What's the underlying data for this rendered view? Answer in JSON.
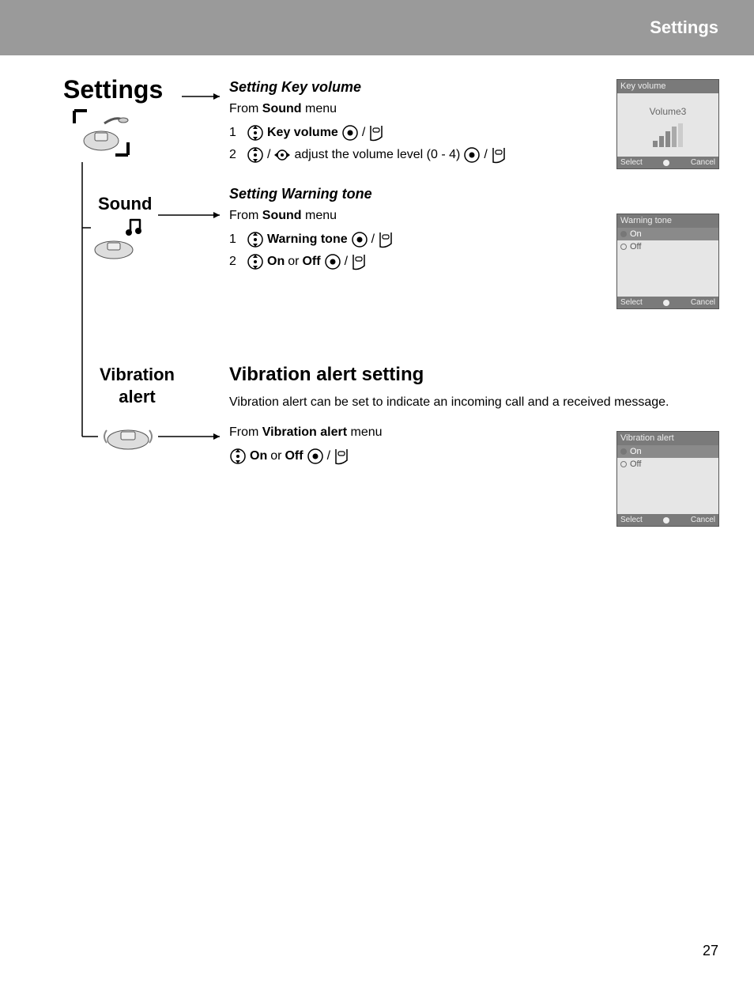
{
  "header": {
    "title": "Settings"
  },
  "page_number": "27",
  "left": {
    "settings_title": "Settings",
    "sound_label": "Sound",
    "vibration_label_line1": "Vibration",
    "vibration_label_line2": "alert"
  },
  "keyvol": {
    "heading": "Setting Key volume",
    "from_pre": "From ",
    "from_bold": "Sound",
    "from_post": " menu",
    "step1_num": "1",
    "step1_bold": "Key volume",
    "step1_sep": " / ",
    "step2_num": "2",
    "step2_sep1": " / ",
    "step2_text": " adjust the volume level (0 - 4) ",
    "step2_sep2": " / "
  },
  "warntone": {
    "heading": "Setting Warning tone",
    "from_pre": "From ",
    "from_bold": "Sound",
    "from_post": " menu",
    "step1_num": "1",
    "step1_bold": "Warning tone",
    "step1_sep": " / ",
    "step2_num": "2",
    "step2_on": "On",
    "step2_or": " or ",
    "step2_off": "Off",
    "step2_sep": " / "
  },
  "vibalert": {
    "heading": "Vibration alert setting",
    "desc": "Vibration alert can be set to indicate an incoming call and a received message.",
    "from_pre": "From ",
    "from_bold": "Vibration alert",
    "from_post": " menu",
    "step_on": "On",
    "step_or": " or ",
    "step_off": "Off",
    "step_sep": " / "
  },
  "screens": {
    "keyvol": {
      "title": "Key volume",
      "value": "Volume3",
      "select": "Select",
      "cancel": "Cancel"
    },
    "warntone": {
      "title": "Warning tone",
      "on": "On",
      "off": "Off",
      "select": "Select",
      "cancel": "Cancel"
    },
    "vibalert": {
      "title": "Vibration alert",
      "on": "On",
      "off": "Off",
      "select": "Select",
      "cancel": "Cancel"
    }
  }
}
